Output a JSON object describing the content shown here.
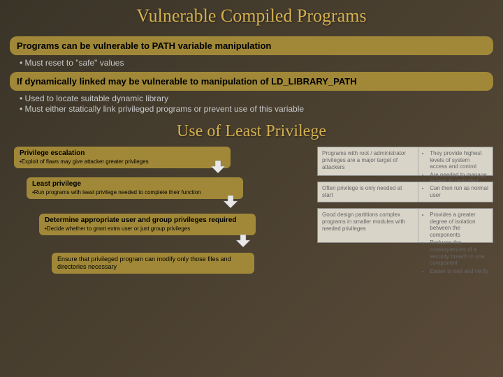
{
  "title1": "Vulnerable Compiled Programs",
  "box1": {
    "head": "Programs can be vulnerable to PATH variable manipulation",
    "bullets": [
      "Must reset to \"safe\" values"
    ]
  },
  "box2": {
    "head": "If dynamically linked may be vulnerable to manipulation of LD_LIBRARY_PATH",
    "bullets": [
      "Used to locate suitable dynamic library",
      "Must either statically link privileged programs or prevent use of this variable"
    ]
  },
  "title2": "Use of Least Privilege",
  "steps": [
    {
      "title": "Privilege escalation",
      "text": "•Exploit of flaws may give attacker greater privileges"
    },
    {
      "title": "Least privilege",
      "text": "•Run programs with least privilege needed to complete their function"
    },
    {
      "title": "Determine appropriate user and group privileges required",
      "text": "•Decide whether to grant extra user or just group privileges"
    },
    {
      "title": "",
      "text": "Ensure that privileged program can modify only those files and directories necessary"
    }
  ],
  "sides": [
    {
      "left": "Programs with root / administrator privileges are a major target of attackers",
      "right": [
        "They provide highest levels of system access and control",
        "Are needed to manage access to protected system resources"
      ]
    },
    {
      "left": "Often privilege is only needed at start",
      "right": [
        "Can then run as normal user"
      ]
    },
    {
      "left": "Good design partitions complex programs in smaller modules with needed privileges",
      "right": [
        "Provides a greater degree of isolation between the components",
        "Reduces the consequences of a security breach in one component",
        "Easier to test and verify"
      ]
    }
  ]
}
